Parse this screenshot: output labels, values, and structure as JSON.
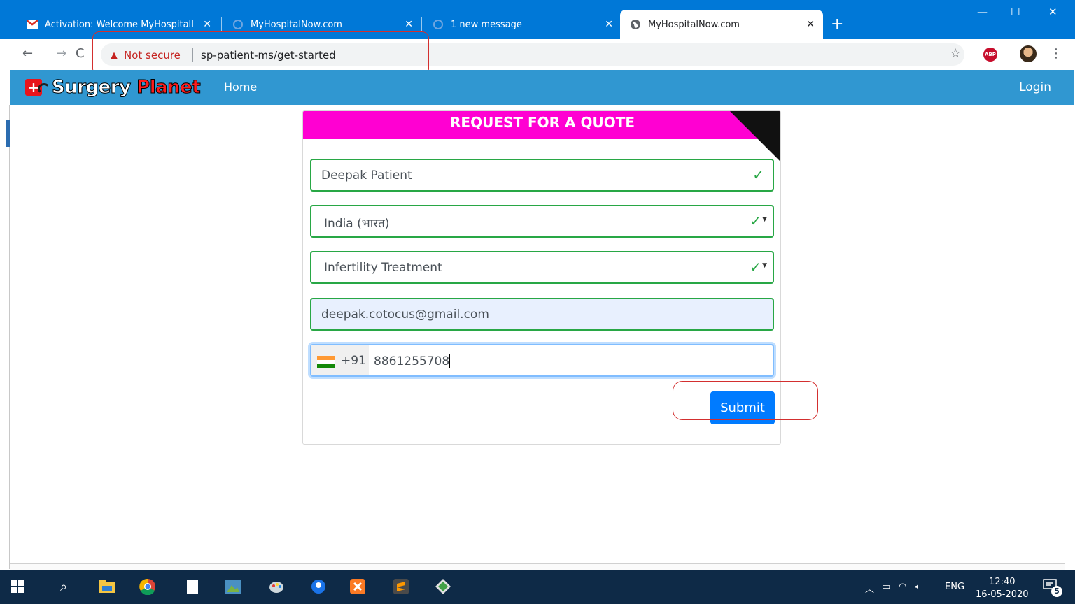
{
  "browser": {
    "tabs": [
      {
        "title": "Activation: Welcome MyHospitalI",
        "favicon": "gmail-icon"
      },
      {
        "title": "MyHospitalNow.com",
        "favicon": "loading-globe-icon"
      },
      {
        "title": "1 new message",
        "favicon": "loading-globe-icon"
      },
      {
        "title": "MyHospitalNow.com",
        "favicon": "globe-icon",
        "active": true
      }
    ],
    "security_label": "Not secure",
    "url": "sp-patient-ms/get-started"
  },
  "site": {
    "logo_word1": "Surgery",
    "logo_word2": "Planet",
    "nav_home": "Home",
    "nav_login": "Login",
    "nav_color": "#3097d1"
  },
  "form": {
    "title": "REQUEST FOR A QUOTE",
    "header_color": "#ff00d2",
    "name_value": "Deepak Patient",
    "country_value": "India (भारत)",
    "treatment_value": "Infertility Treatment",
    "email_value": "deepak.cotocus@gmail.com",
    "dial_code": "+91",
    "phone_value": "8861255708",
    "submit_label": "Submit"
  },
  "taskbar": {
    "language": "ENG",
    "time": "12:40",
    "date": "16-05-2020",
    "notifications": "5"
  }
}
